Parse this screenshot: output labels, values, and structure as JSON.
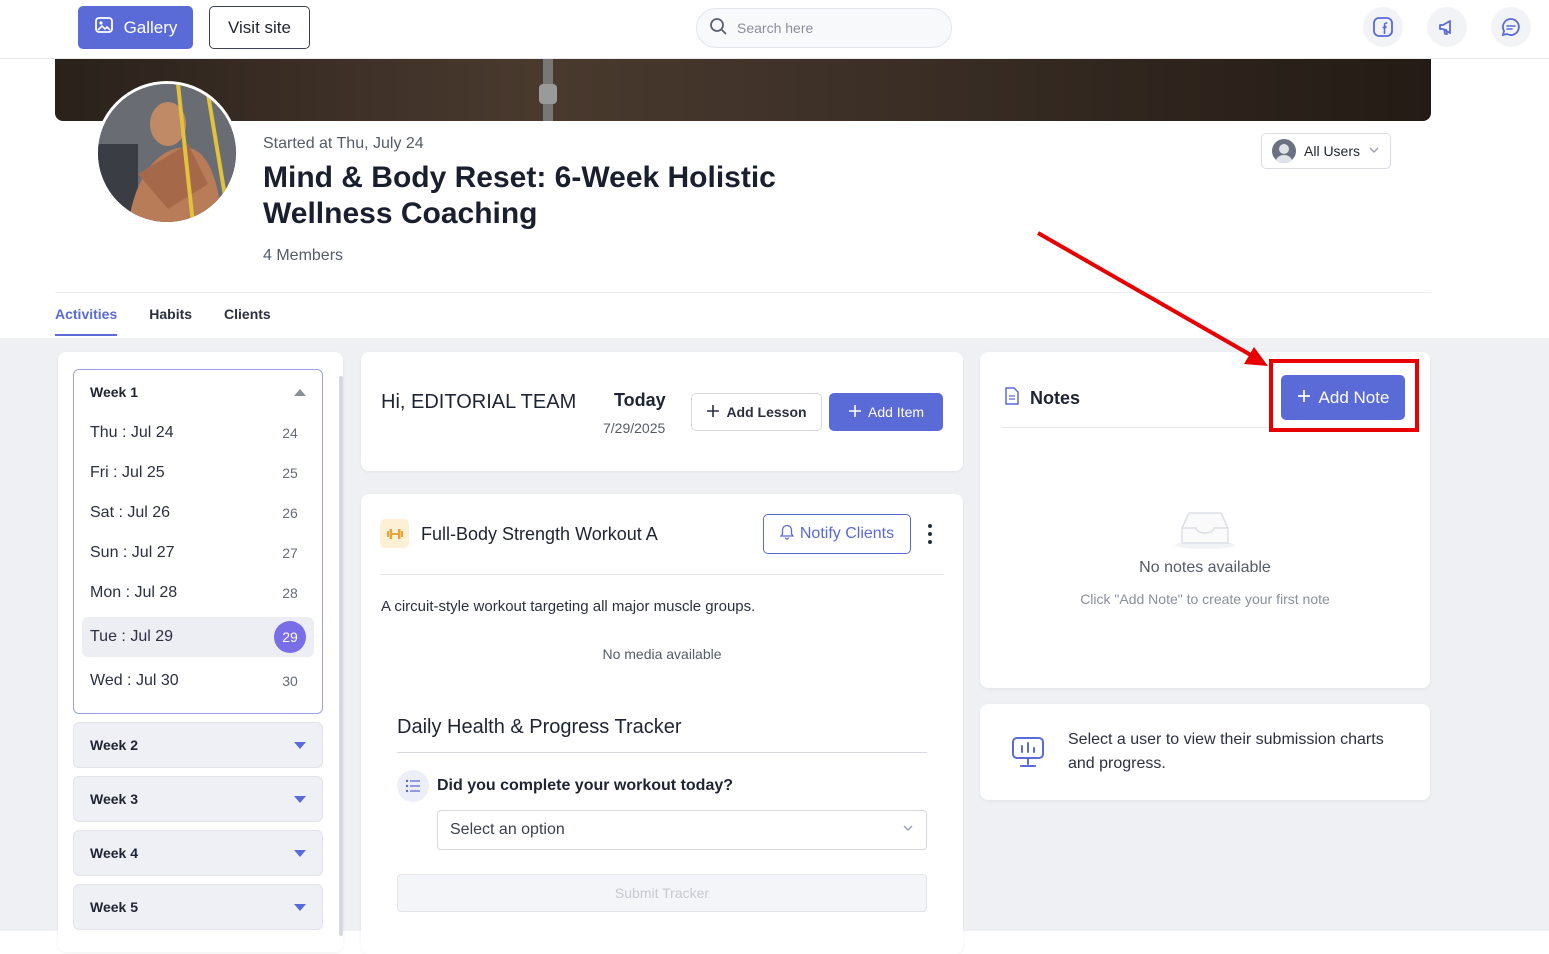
{
  "topbar": {
    "gallery_label": "Gallery",
    "visit_label": "Visit site",
    "search_placeholder": "Search here"
  },
  "program": {
    "started": "Started at Thu, July 24",
    "title": "Mind & Body Reset: 6-Week Holistic Wellness Coaching",
    "members": "4 Members",
    "user_filter": "All Users"
  },
  "tabs": [
    "Activities",
    "Habits",
    "Clients"
  ],
  "weeks": {
    "week1": {
      "label": "Week 1",
      "days": [
        {
          "label": "Thu : Jul 24",
          "num": "24"
        },
        {
          "label": "Fri : Jul 25",
          "num": "25"
        },
        {
          "label": "Sat : Jul 26",
          "num": "26"
        },
        {
          "label": "Sun : Jul 27",
          "num": "27"
        },
        {
          "label": "Mon : Jul 28",
          "num": "28"
        },
        {
          "label": "Tue : Jul 29",
          "num": "29"
        },
        {
          "label": "Wed : Jul 30",
          "num": "30"
        }
      ]
    },
    "others": [
      "Week 2",
      "Week 3",
      "Week 4",
      "Week 5"
    ]
  },
  "greeting": {
    "text": "Hi, EDITORIAL TEAM",
    "today_label": "Today",
    "date": "7/29/2025",
    "add_lesson": "Add Lesson",
    "add_item": "Add Item"
  },
  "workout": {
    "title": "Full-Body Strength Workout A",
    "notify": "Notify Clients",
    "description": "A circuit-style workout targeting all major muscle groups.",
    "no_media": "No media available",
    "tracker_title": "Daily Health & Progress Tracker",
    "question": "Did you complete your workout today?",
    "select_placeholder": "Select an option",
    "submit": "Submit Tracker"
  },
  "notes": {
    "title": "Notes",
    "add_note": "Add Note",
    "empty_title": "No notes available",
    "empty_hint": "Click \"Add Note\" to create your first note"
  },
  "charts": {
    "text": "Select a user to view their submission charts and progress."
  },
  "colors": {
    "accent": "#5a6ad6",
    "selected_day": "#7a6ee8",
    "annotation": "#e80000"
  }
}
